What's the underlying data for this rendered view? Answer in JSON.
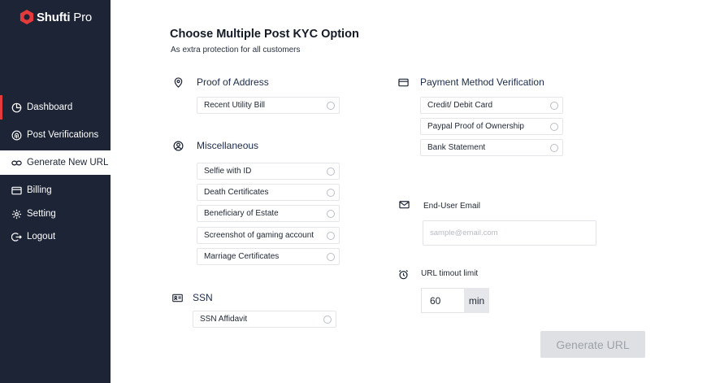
{
  "brand": {
    "name_bold": "Shufti",
    "name_light": "Pro",
    "accent_color": "#e53a3a"
  },
  "sidebar": {
    "items": [
      {
        "label": "Dashboard",
        "icon": "pie-chart-icon"
      },
      {
        "label": "Post Verifications",
        "icon": "fingerprint-icon"
      },
      {
        "label": "Generate New URL",
        "icon": "link-icon"
      },
      {
        "label": "Billing",
        "icon": "credit-card-icon"
      },
      {
        "label": "Setting",
        "icon": "gear-icon"
      },
      {
        "label": "Logout",
        "icon": "logout-icon"
      }
    ]
  },
  "main": {
    "title": "Choose Multiple Post KYC Option",
    "subtitle": "As extra protection for all customers",
    "proof_of_address": {
      "heading": "Proof of Address",
      "icon": "location-pin-icon",
      "options": [
        "Recent Utility Bill"
      ]
    },
    "miscellaneous": {
      "heading": "Miscellaneous",
      "icon": "user-circle-icon",
      "options": [
        "Selfie with ID",
        "Death Certificates",
        "Beneficiary of Estate",
        "Screenshot of gaming account",
        "Marriage Certificates"
      ]
    },
    "ssn": {
      "heading": "SSN",
      "icon": "id-card-icon",
      "options": [
        "SSN Affidavit"
      ]
    },
    "payment": {
      "heading": "Payment Method Verification",
      "icon": "credit-card-icon",
      "options": [
        "Credit/ Debit Card",
        "Paypal Proof of Ownership",
        "Bank Statement"
      ]
    },
    "email": {
      "label": "End-User Email",
      "icon": "envelope-icon",
      "placeholder": "sample@email.com"
    },
    "timeout": {
      "label": "URL timout limit",
      "icon": "alarm-clock-icon",
      "value": "60",
      "unit": "min"
    },
    "generate_button": "Generate URL"
  }
}
